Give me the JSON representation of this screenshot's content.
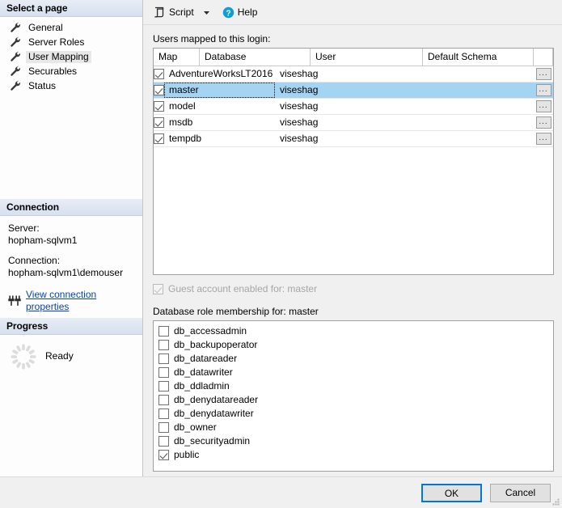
{
  "sidebar": {
    "select_page_header": "Select a page",
    "pages": [
      {
        "label": "General",
        "icon": "wrench-icon",
        "selected": false
      },
      {
        "label": "Server Roles",
        "icon": "wrench-icon",
        "selected": false
      },
      {
        "label": "User Mapping",
        "icon": "wrench-icon",
        "selected": true
      },
      {
        "label": "Securables",
        "icon": "wrench-icon",
        "selected": false
      },
      {
        "label": "Status",
        "icon": "wrench-icon",
        "selected": false
      }
    ],
    "connection_header": "Connection",
    "server_label": "Server:",
    "server_value": "hopham-sqlvm1",
    "connection_label": "Connection:",
    "connection_value": "hopham-sqlvm1\\demouser",
    "view_connection_link": "View connection properties",
    "link_color": "#0645ad",
    "progress_header": "Progress",
    "progress_status": "Ready"
  },
  "toolbar": {
    "script_label": "Script",
    "script_icon": "script-icon",
    "dropdown_icon": "chevron-down-icon",
    "help_label": "Help",
    "help_icon": "help-circle-icon",
    "help_icon_color": "#0a9fdc"
  },
  "main": {
    "users_label": "Users mapped to this login:",
    "grid": {
      "columns": [
        "Map",
        "Database",
        "User",
        "Default Schema"
      ],
      "ellipsis_button_label": "...",
      "rows": [
        {
          "map": true,
          "database": "AdventureWorksLT2016",
          "user": "viseshag",
          "schema": "",
          "selected": false
        },
        {
          "map": true,
          "database": "master",
          "user": "viseshag",
          "schema": "",
          "selected": true
        },
        {
          "map": true,
          "database": "model",
          "user": "viseshag",
          "schema": "",
          "selected": false
        },
        {
          "map": true,
          "database": "msdb",
          "user": "viseshag",
          "schema": "",
          "selected": false
        },
        {
          "map": true,
          "database": "tempdb",
          "user": "viseshag",
          "schema": "",
          "selected": false
        }
      ]
    },
    "guest_account": {
      "label": "Guest account enabled for: master",
      "checked": true,
      "disabled": true
    },
    "role_membership_label": "Database role membership for: master",
    "roles": [
      {
        "label": "db_accessadmin",
        "checked": false
      },
      {
        "label": "db_backupoperator",
        "checked": false
      },
      {
        "label": "db_datareader",
        "checked": false
      },
      {
        "label": "db_datawriter",
        "checked": false
      },
      {
        "label": "db_ddladmin",
        "checked": false
      },
      {
        "label": "db_denydatareader",
        "checked": false
      },
      {
        "label": "db_denydatawriter",
        "checked": false
      },
      {
        "label": "db_owner",
        "checked": false
      },
      {
        "label": "db_securityadmin",
        "checked": false
      },
      {
        "label": "public",
        "checked": true
      }
    ]
  },
  "footer": {
    "ok_label": "OK",
    "cancel_label": "Cancel",
    "focus_color": "#0078d7"
  }
}
